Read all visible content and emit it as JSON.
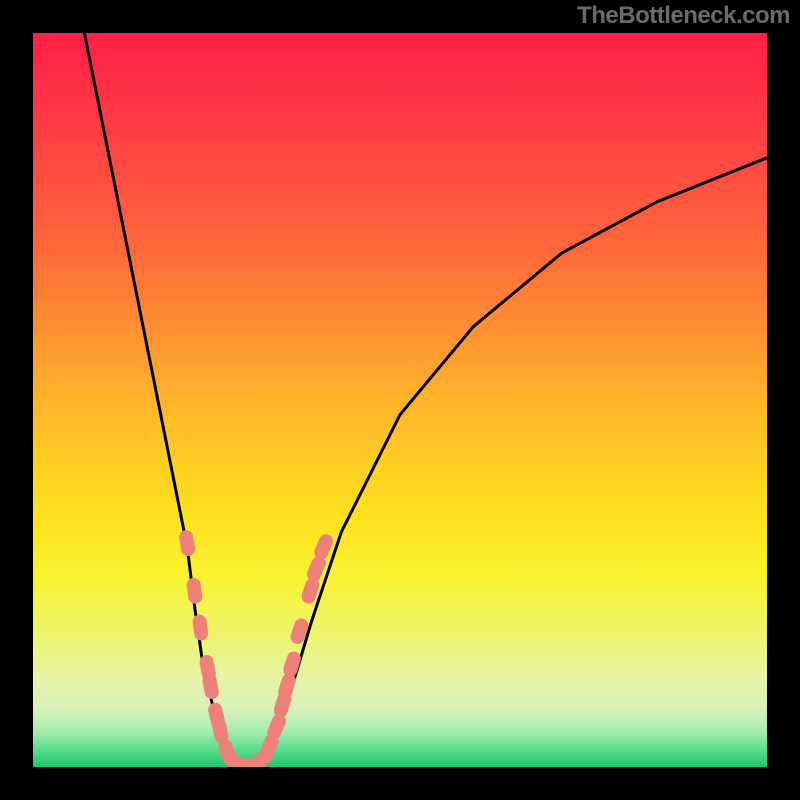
{
  "watermark": {
    "text": "TheBottleneck.com"
  },
  "colors": {
    "bg_black": "#000000",
    "curve": "#000000",
    "marker_fill": "#ed8079",
    "gradient_stops": [
      {
        "offset": 0.0,
        "color": "#ff1f46"
      },
      {
        "offset": 0.12,
        "color": "#ff3a44"
      },
      {
        "offset": 0.3,
        "color": "#ff6a3a"
      },
      {
        "offset": 0.5,
        "color": "#ffb42a"
      },
      {
        "offset": 0.66,
        "color": "#ffe21e"
      },
      {
        "offset": 0.74,
        "color": "#f8f230"
      },
      {
        "offset": 0.82,
        "color": "#edf56d"
      },
      {
        "offset": 0.88,
        "color": "#e6f3a5"
      },
      {
        "offset": 0.92,
        "color": "#d9f2b9"
      },
      {
        "offset": 0.95,
        "color": "#a8edb0"
      },
      {
        "offset": 0.975,
        "color": "#5fdf8e"
      },
      {
        "offset": 1.0,
        "color": "#18c86e"
      }
    ]
  },
  "chart_data": {
    "type": "line",
    "title": "",
    "xlabel": "",
    "ylabel": "",
    "xlim": [
      0,
      100
    ],
    "ylim": [
      0,
      100
    ],
    "left_curve_approx": [
      {
        "x": 7,
        "y": 100
      },
      {
        "x": 10,
        "y": 85
      },
      {
        "x": 13,
        "y": 70
      },
      {
        "x": 16,
        "y": 55
      },
      {
        "x": 19,
        "y": 40
      },
      {
        "x": 21,
        "y": 30
      },
      {
        "x": 22,
        "y": 22
      },
      {
        "x": 23,
        "y": 15
      },
      {
        "x": 25,
        "y": 6
      },
      {
        "x": 26,
        "y": 2
      },
      {
        "x": 27,
        "y": 0.5
      },
      {
        "x": 29,
        "y": 0
      }
    ],
    "right_curve_approx": [
      {
        "x": 29,
        "y": 0
      },
      {
        "x": 31,
        "y": 0.5
      },
      {
        "x": 33,
        "y": 4
      },
      {
        "x": 35,
        "y": 10
      },
      {
        "x": 38,
        "y": 20
      },
      {
        "x": 42,
        "y": 32
      },
      {
        "x": 50,
        "y": 48
      },
      {
        "x": 60,
        "y": 60
      },
      {
        "x": 72,
        "y": 70
      },
      {
        "x": 85,
        "y": 77
      },
      {
        "x": 100,
        "y": 83
      }
    ],
    "series": [
      {
        "name": "markers",
        "points": [
          {
            "x": 21.0,
            "y": 30.5
          },
          {
            "x": 22.0,
            "y": 24.0
          },
          {
            "x": 22.8,
            "y": 19.0
          },
          {
            "x": 23.8,
            "y": 13.5
          },
          {
            "x": 24.2,
            "y": 11.0
          },
          {
            "x": 25.0,
            "y": 7.0
          },
          {
            "x": 25.5,
            "y": 5.0
          },
          {
            "x": 26.5,
            "y": 2.0
          },
          {
            "x": 27.5,
            "y": 0.7
          },
          {
            "x": 28.5,
            "y": 0.3
          },
          {
            "x": 29.5,
            "y": 0.2
          },
          {
            "x": 30.5,
            "y": 0.4
          },
          {
            "x": 31.2,
            "y": 1.0
          },
          {
            "x": 32.2,
            "y": 2.8
          },
          {
            "x": 33.2,
            "y": 5.5
          },
          {
            "x": 34.0,
            "y": 8.5
          },
          {
            "x": 34.6,
            "y": 11.0
          },
          {
            "x": 35.3,
            "y": 14.0
          },
          {
            "x": 36.3,
            "y": 18.5
          },
          {
            "x": 37.8,
            "y": 24.0
          },
          {
            "x": 38.6,
            "y": 27.0
          },
          {
            "x": 39.6,
            "y": 30.0
          }
        ]
      }
    ]
  }
}
